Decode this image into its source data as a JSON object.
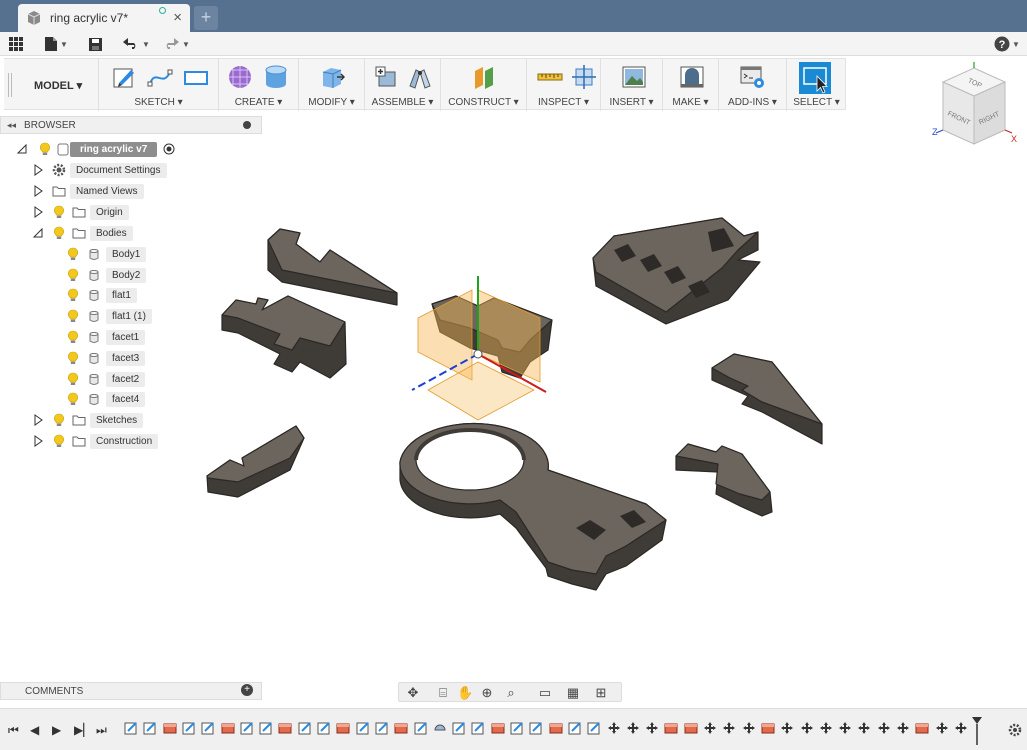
{
  "tab": {
    "title": "ring acrylic v7*",
    "close_glyph": "×",
    "new_glyph": "+"
  },
  "toolbar": {
    "workspace": "MODEL ▾",
    "groups": [
      {
        "label": "SKETCH ▾"
      },
      {
        "label": "CREATE ▾"
      },
      {
        "label": "MODIFY ▾"
      },
      {
        "label": "ASSEMBLE ▾"
      },
      {
        "label": "CONSTRUCT ▾"
      },
      {
        "label": "INSPECT ▾"
      },
      {
        "label": "INSERT ▾"
      },
      {
        "label": "MAKE ▾"
      },
      {
        "label": "ADD-INS ▾"
      },
      {
        "label": "SELECT ▾"
      }
    ]
  },
  "viewcube": {
    "top": "TOP",
    "front": "FRONT",
    "right": "RIGHT",
    "z": "Z",
    "x": "X"
  },
  "browser": {
    "title": "BROWSER",
    "collapse_glyph": "◂◂",
    "root": "ring acrylic v7",
    "items": {
      "document_settings": "Document Settings",
      "named_views": "Named Views",
      "origin": "Origin",
      "bodies": "Bodies",
      "body1": "Body1",
      "body2": "Body2",
      "flat1": "flat1",
      "flat1_1": "flat1 (1)",
      "facet1": "facet1",
      "facet3": "facet3",
      "facet2": "facet2",
      "facet4": "facet4",
      "sketches": "Sketches",
      "construction": "Construction"
    }
  },
  "comments": {
    "title": "COMMENTS",
    "expand_glyph": "+"
  },
  "colors": {
    "tabbar": "#56718f",
    "body_fill": "#5d5751",
    "select_accent": "#1a8ad4",
    "bulb": "#f2c81c",
    "plane": "#f7b955"
  },
  "icons": [
    "grid-icon",
    "file-icon",
    "save-icon",
    "undo-icon",
    "redo-icon",
    "help-icon",
    "bulb-icon",
    "folder-icon",
    "gear-icon",
    "body-icon",
    "orbit-icon",
    "pan-icon",
    "zoom-icon",
    "display-icon",
    "grid-display-icon",
    "viewport-icon"
  ]
}
